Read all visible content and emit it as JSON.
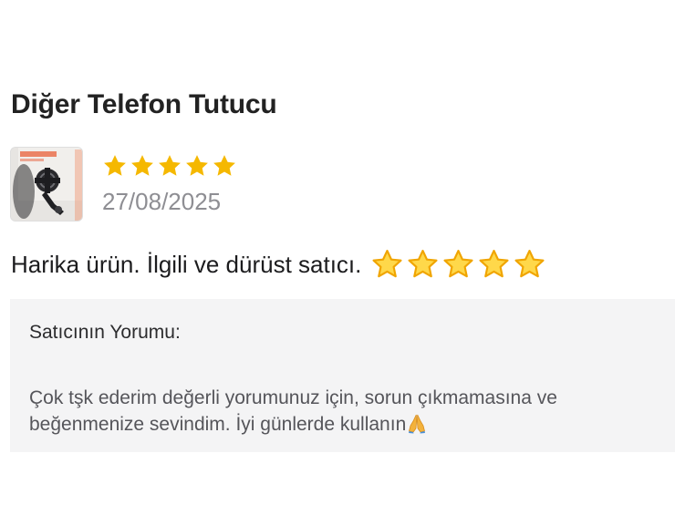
{
  "product": {
    "title": "Diğer Telefon Tutucu"
  },
  "review": {
    "rating": 5,
    "rating_max": 5,
    "date": "27/08/2025",
    "text": "Harika ürün. İlgili ve dürüst satıcı.",
    "trailing_emoji": [
      "star-emoji",
      "star-emoji",
      "star-emoji",
      "star-emoji",
      "star-emoji"
    ],
    "thumbnail": "product-photo-phone-holder"
  },
  "seller_comment": {
    "label": "Satıcının Yorumu:",
    "text_line1": "Çok tşk ederim değerli yorumunuz için, sorun çıkmamasına ve",
    "text_line2": "beğenmenize sevindim. İyi günlerde kullanın",
    "emoji": "folded-hands-emoji"
  },
  "colors": {
    "star": "#f5b800",
    "background": "#ffffff",
    "seller_box": "#f4f4f5",
    "date": "#8e8e93"
  }
}
